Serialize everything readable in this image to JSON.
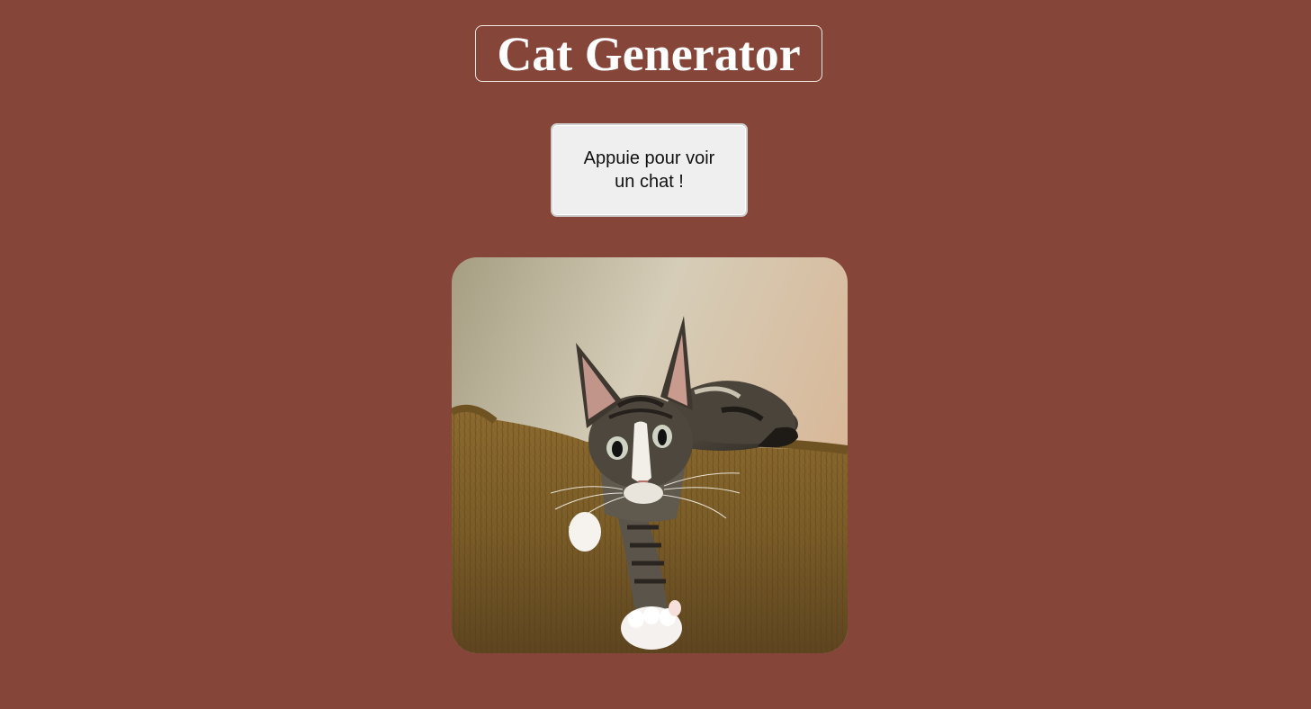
{
  "header": {
    "title": "Cat Generator"
  },
  "action": {
    "button_label": "Appuie pour voir un chat !"
  },
  "image": {
    "alt": "chat"
  },
  "colors": {
    "background": "#854538",
    "button_bg": "#efefef",
    "title_text": "#ffffff"
  }
}
